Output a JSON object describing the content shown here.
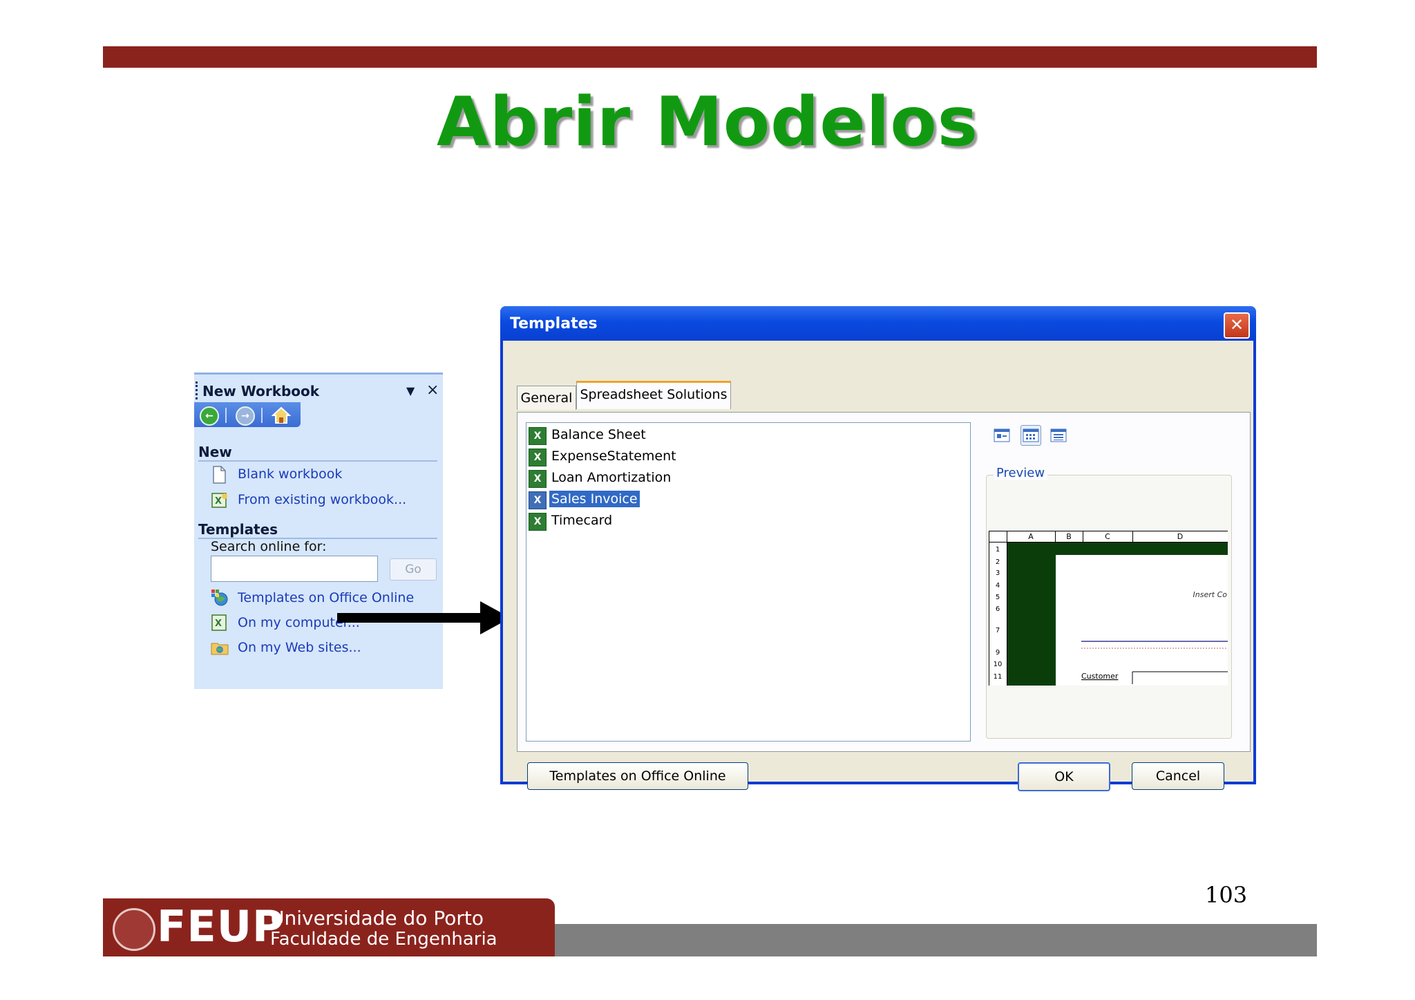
{
  "slide": {
    "title": "Abrir Modelos",
    "page_number": "103",
    "accent_color": "#8b231d",
    "title_color": "#119a11"
  },
  "task_pane": {
    "title": "New Workbook",
    "section_new": "New",
    "new_links": [
      "Blank workbook",
      "From existing workbook..."
    ],
    "section_templates": "Templates",
    "search_label": "Search online for:",
    "search_value": "",
    "go_button": "Go",
    "template_links": [
      "Templates on Office Online",
      "On my computer...",
      "On my Web sites..."
    ]
  },
  "dialog": {
    "title": "Templates",
    "tabs": [
      "General",
      "Spreadsheet Solutions"
    ],
    "active_tab": "Spreadsheet Solutions",
    "files": [
      "Balance Sheet",
      "ExpenseStatement",
      "Loan Amortization",
      "Sales Invoice",
      "Timecard"
    ],
    "selected_file": "Sales Invoice",
    "preview_label": "Preview",
    "preview_columns": [
      "A",
      "B",
      "C",
      "D"
    ],
    "preview_rows": [
      "1",
      "2",
      "3",
      "4",
      "5",
      "6",
      "7",
      "9",
      "10",
      "11"
    ],
    "preview_insert_text": "Insert Co",
    "preview_customer_text": "Customer",
    "buttons": {
      "online": "Templates on Office Online",
      "ok": "OK",
      "cancel": "Cancel"
    }
  },
  "footer": {
    "logo_text": "FEUP",
    "university": "Universidade do Porto",
    "faculty": "Faculdade de Engenharia"
  }
}
